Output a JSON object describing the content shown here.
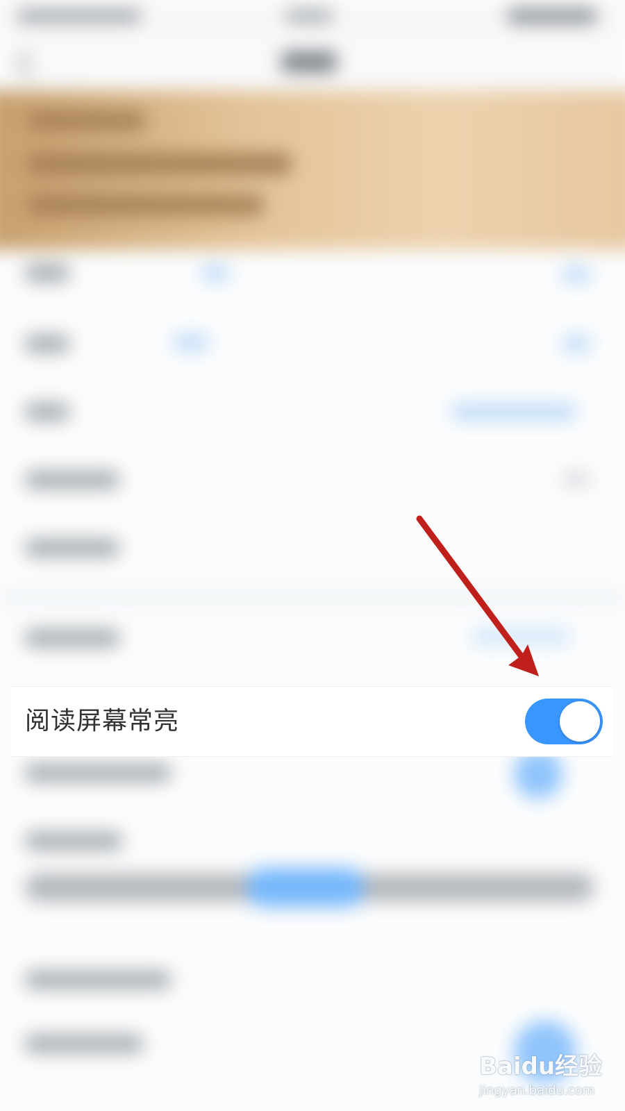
{
  "setting": {
    "label": "阅读屏幕常亮",
    "enabled": true
  },
  "colors": {
    "toggle_on": "#3a96ff",
    "annotation_arrow": "#c0201b",
    "banner": "#e3c398"
  },
  "watermark": {
    "logo": "Baidu经验",
    "url": "jingyan.baidu.com"
  }
}
